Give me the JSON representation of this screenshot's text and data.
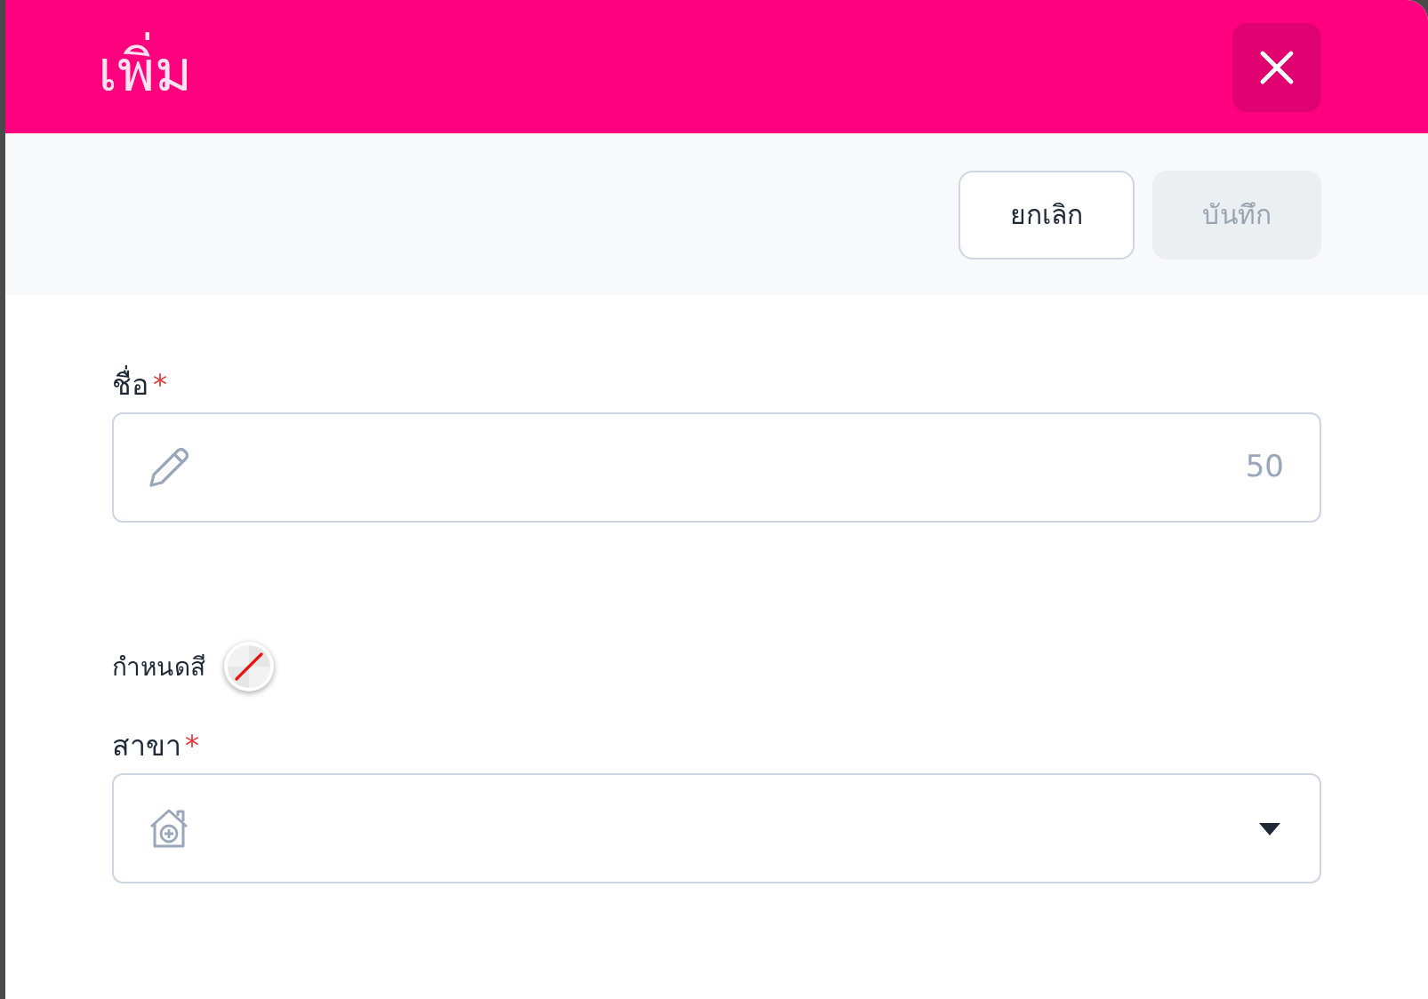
{
  "dialog": {
    "title": "เพิ่ม"
  },
  "actions": [
    {
      "label": "ยกเลิก",
      "disabled": false
    },
    {
      "label": "บันทึก",
      "disabled": true
    }
  ],
  "name_field": {
    "label": "ชื่อ",
    "required_mark": "*",
    "counter": "50"
  },
  "color_picker": {
    "label": "กำหนดสี"
  },
  "branch_field": {
    "label": "สาขา",
    "required_mark": "*"
  }
}
